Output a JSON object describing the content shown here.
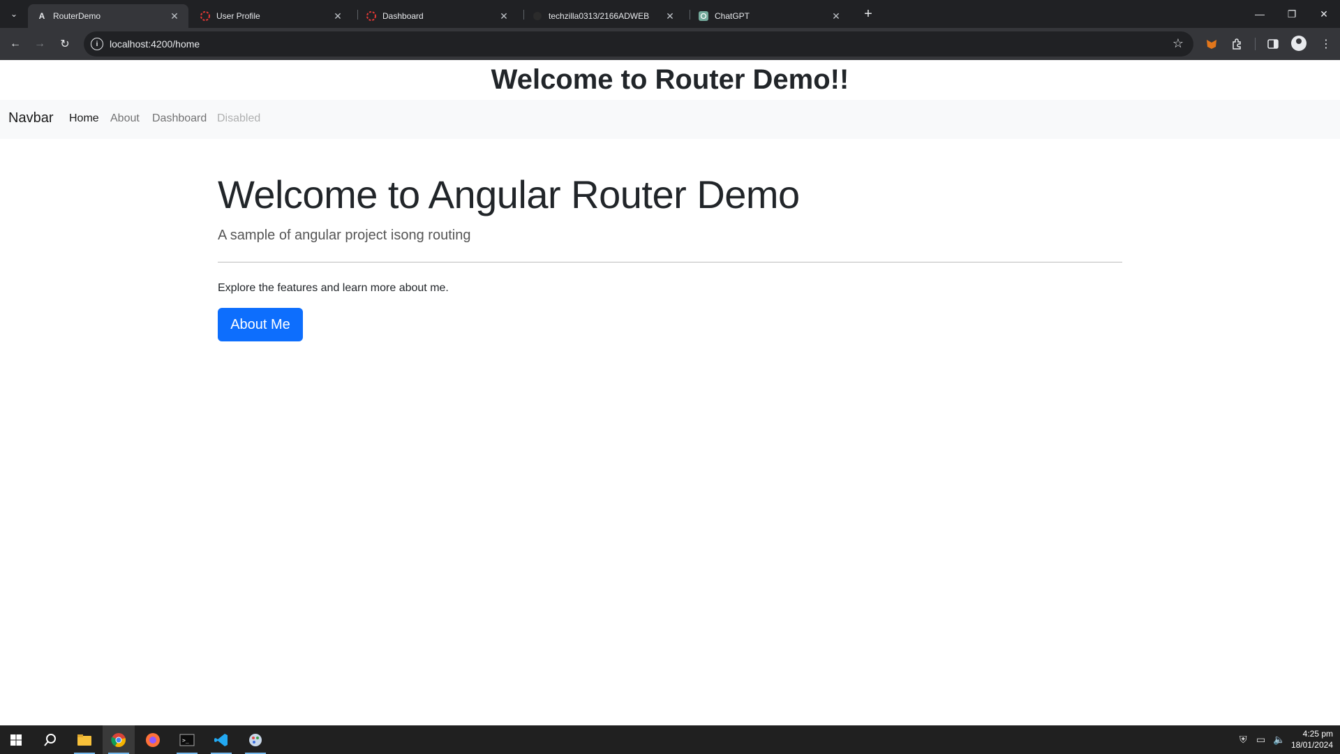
{
  "browser": {
    "tabs": [
      {
        "title": "RouterDemo",
        "favicon": "angular-icon",
        "active": true
      },
      {
        "title": "User Profile",
        "favicon": "loading-icon",
        "active": false
      },
      {
        "title": "Dashboard",
        "favicon": "loading-icon",
        "active": false
      },
      {
        "title": "techzilla0313/2166ADWEB",
        "favicon": "github-icon",
        "active": false
      },
      {
        "title": "ChatGPT",
        "favicon": "chatgpt-icon",
        "active": false
      }
    ],
    "url": "localhost:4200/home"
  },
  "page": {
    "heading": "Welcome to Router Demo!!",
    "navbar": {
      "brand": "Navbar",
      "links": [
        "Home",
        "About",
        "Dashboard",
        "Disabled"
      ]
    },
    "jumbotron": {
      "title": "Welcome to Angular Router Demo",
      "lead": "A sample of angular project isong routing",
      "text": "Explore the features and learn more about me.",
      "button": "About Me"
    }
  },
  "taskbar": {
    "time": "4:25 pm",
    "date": "18/01/2024"
  },
  "colors": {
    "primary": "#0d6efd",
    "navbar_bg": "#f8f9fa",
    "chrome_dark": "#202124",
    "chrome_toolbar": "#35363a"
  }
}
